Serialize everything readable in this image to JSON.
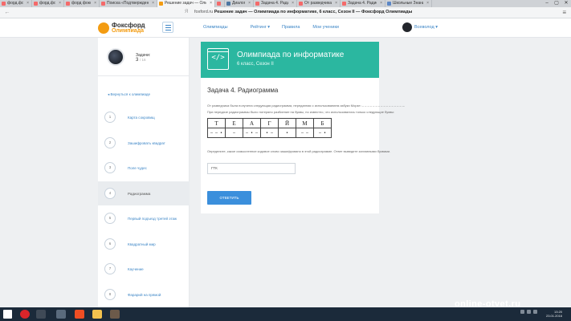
{
  "browser": {
    "tabs": [
      {
        "title": "форд.фокс.ru — Яндекс.ню",
        "color": "#f46a6a",
        "active": false
      },
      {
        "title": "форд.фокс.ru — Яндекс.ню",
        "color": "#f46a6a",
        "active": false
      },
      {
        "title": "форд фокс.ru — Яндекс.нас",
        "color": "#f46a6a",
        "active": false
      },
      {
        "title": "Поиска «Подтверждение п…",
        "color": "#f46a6a",
        "active": false
      },
      {
        "title": "Решение задач — Олим",
        "color": "#f39c12",
        "active": true
      },
      {
        "title": "",
        "color": "#f46a6a",
        "active": false
      },
      {
        "title": "Диалоги",
        "color": "#4d76a1",
        "active": false
      },
      {
        "title": "Задача 4. Радиограмма От",
        "color": "#f46a6a",
        "active": false
      },
      {
        "title": "От разведчика была получе",
        "color": "#f46a6a",
        "active": false
      },
      {
        "title": "Задача 4. Радиограмма От",
        "color": "#f46a6a",
        "active": false
      },
      {
        "title": "Школьные Знания.com - Р…",
        "color": "#5c87c6",
        "active": false
      }
    ],
    "yandex_label": "Я",
    "url_domain": "foxford.ru",
    "url_title": "Решение задач — Олимпиада по информатике, 6 класс, Сезон II — Фоксфорд Олимпиады"
  },
  "header": {
    "logo_title": "Фоксфорд",
    "logo_sub": "Олимпиада",
    "nav": [
      {
        "label": "Олимпиады"
      },
      {
        "label": "Рейтинг ▾"
      },
      {
        "label": "Правила"
      },
      {
        "label": "Мои ученики"
      }
    ],
    "user_name": "Всеволод ▾"
  },
  "sidebar": {
    "tasks_label": "Задачи:",
    "score": "3",
    "score_total": "/ 16",
    "back_link": "◂  Вернуться к олимпиаде",
    "steps": [
      {
        "num": "1",
        "name": "Карта сокровищ"
      },
      {
        "num": "2",
        "name": "Зашифровать квадрат"
      },
      {
        "num": "3",
        "name": "Поле чудес"
      },
      {
        "num": "4",
        "name": "Радиограмма"
      },
      {
        "num": "5",
        "name": "Первый подъезд третей этаж"
      },
      {
        "num": "6",
        "name": "Квадратный мир"
      },
      {
        "num": "7",
        "name": "Каучение"
      },
      {
        "num": "8",
        "name": "Фарарий на прямой"
      }
    ]
  },
  "main": {
    "banner_title": "Олимпиада по информатике",
    "banner_sub": "6 класс, Сезон II",
    "code_icon": "</>",
    "task_title": "Задача 4. Радиограмма",
    "para1": "От разведчика была получена следующая радиограмма, переданная с использованием азбуки Морзе: – – – – – – – – – – – – – – – –.",
    "para2": "При передаче радиограммы было потеряно разбиение на буквы, но известно, что использовались только следующие буквы:",
    "letters": [
      "Т",
      "Е",
      "А",
      "Г",
      "Й",
      "М",
      "Б"
    ],
    "morse": [
      "– – •",
      "–",
      "– • –",
      "• –",
      "•",
      "– –",
      "– •"
    ],
    "para3": "Определите, какое осмысленное кодовое слово зашифровано в этой радиограмме. Ответ выведите заглавными буквами.",
    "answer_value": "ГТК",
    "submit_label": "ОТВЕТИТЬ"
  },
  "taskbar": {
    "icons": [
      {
        "name": "opera-icon",
        "color": "#d9252a"
      },
      {
        "name": "steam-icon",
        "color": "#3f4a57"
      },
      {
        "name": "game-icon",
        "color": "#5a6b7d"
      },
      {
        "name": "yandex-browser-icon",
        "color": "#f04e23"
      },
      {
        "name": "file-explorer-icon",
        "color": "#f2c14e"
      },
      {
        "name": "app-icon",
        "color": "#6c5a4a"
      }
    ],
    "time": "13:20",
    "date": "23.01.2016"
  },
  "watermark": "online-otvet.ru",
  "colors": {
    "accent": "#3b85c6",
    "banner": "#2bb7a0",
    "brand": "#f39c12",
    "button": "#3b8fdc"
  }
}
